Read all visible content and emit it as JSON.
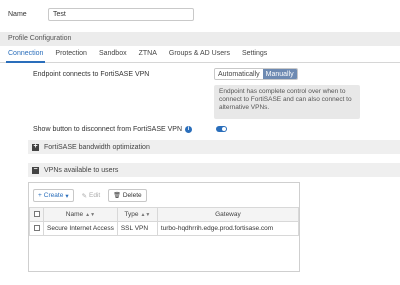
{
  "name_field": {
    "label": "Name",
    "value": "Test"
  },
  "profile_header": "Profile Configuration",
  "tabs": [
    {
      "label": "Connection",
      "active": true
    },
    {
      "label": "Protection",
      "active": false
    },
    {
      "label": "Sandbox",
      "active": false
    },
    {
      "label": "ZTNA",
      "active": false
    },
    {
      "label": "Groups & AD Users",
      "active": false
    },
    {
      "label": "Settings",
      "active": false
    }
  ],
  "endpoint": {
    "label": "Endpoint connects to FortiSASE VPN",
    "options": [
      "Automatically",
      "Manually"
    ],
    "selected": "Manually",
    "info": "Endpoint has complete control over when to connect to FortiSASE and can also connect to alternative VPNs."
  },
  "show_disconnect": {
    "label": "Show button to disconnect from FortiSASE VPN",
    "info_glyph": "i",
    "enabled": true
  },
  "sections": {
    "bandwidth": {
      "label": "FortiSASE bandwidth optimization",
      "glyph": "+"
    },
    "vpns": {
      "label": "VPNs available to users",
      "glyph": "−"
    }
  },
  "toolbar": {
    "create_label": "Create",
    "create_icon": "+",
    "create_caret": "▾",
    "edit_label": "Edit",
    "edit_icon": "✎",
    "delete_label": "Delete",
    "delete_icon": "🗑"
  },
  "table": {
    "headers": {
      "name": "Name",
      "type": "Type",
      "gateway": "Gateway"
    },
    "rows": [
      {
        "name": "Secure Internet Access",
        "type": "SSL VPN",
        "gateway": "turbo-hqdhrrih.edge.prod.fortisase.com"
      }
    ]
  },
  "colors": {
    "accent": "#2a6ebb",
    "segment_active": "#6e8ab2"
  }
}
